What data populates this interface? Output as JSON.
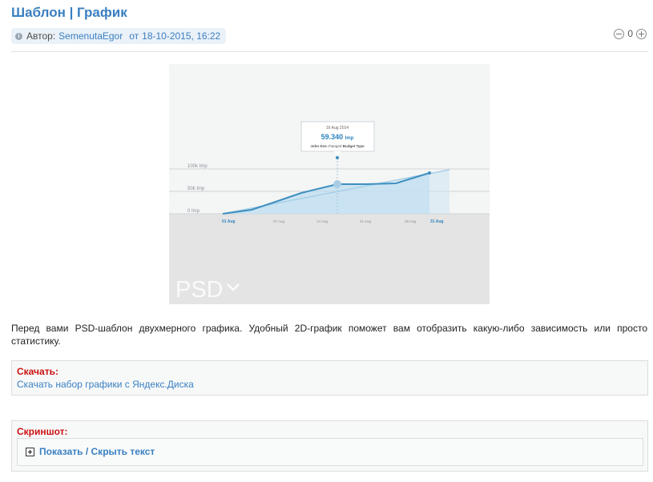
{
  "post": {
    "title": "Шаблон | График",
    "meta": {
      "author_prefix": "Автор:",
      "author": "SemenutaEgor",
      "date_prefix": "от",
      "date": "18-10-2015, 16:22"
    },
    "rating": {
      "value": "0",
      "minus_icon": "minus-circle-icon",
      "plus_icon": "plus-circle-icon"
    },
    "preview": {
      "tooltip": {
        "date": "16 Aug 2014",
        "value": "59.340",
        "unit": "Imp",
        "note_user": "John Doe",
        "note_mid": "changed",
        "note_field": "Budget Type"
      },
      "y_labels": [
        "100k Imp",
        "50k Imp",
        "0 Imp"
      ],
      "x_labels": [
        "01 Aug",
        "07 Aug",
        "14 Aug",
        "21 Aug",
        "28 Aug",
        "31 Aug"
      ],
      "watermark": "PSD",
      "colors": {
        "line": "#3d8fc0",
        "area": "#b9dcf0",
        "bg": "#f4f5f5",
        "lower": "#e4e4e4"
      }
    },
    "description": "Перед вами PSD-шаблон двухмерного графика. Удобный 2D-график поможет вам отобразить какую-либо зависимость или просто статистику.",
    "download": {
      "heading": "Скачать:",
      "link": "Скачать набор графики с Яндекс.Диска"
    },
    "screenshot": {
      "heading": "Скриншот:",
      "toggle": "Показать / Скрыть текст"
    }
  }
}
